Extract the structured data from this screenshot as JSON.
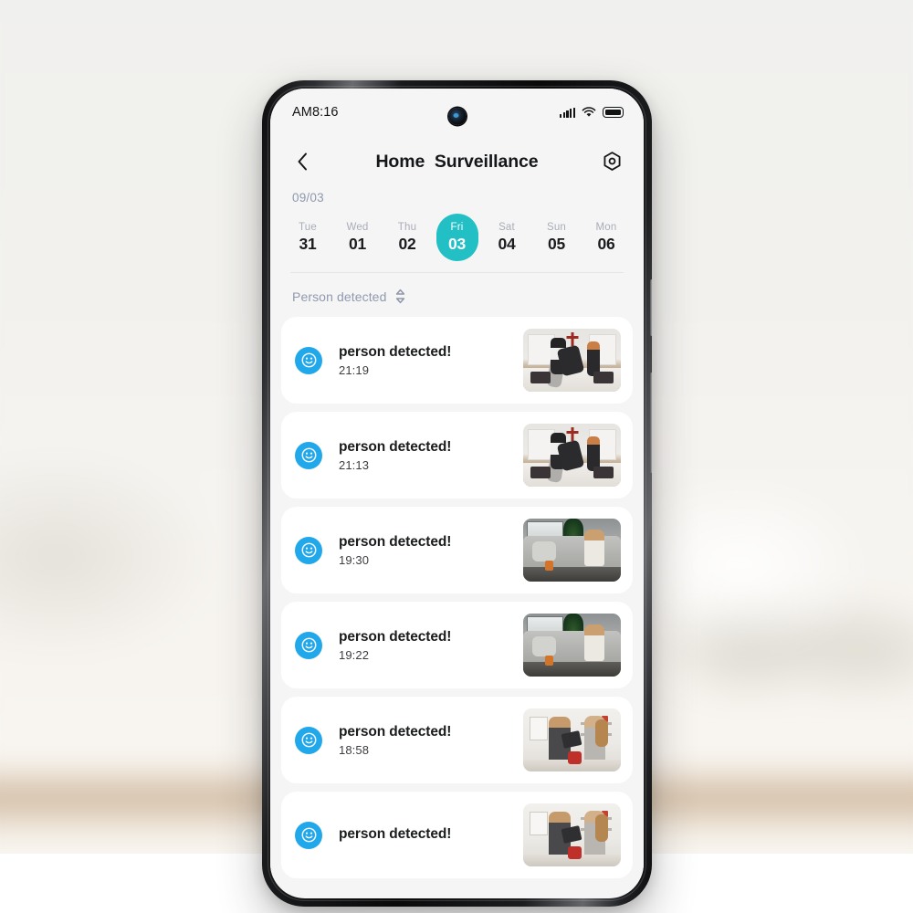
{
  "status_bar": {
    "time": "AM8:16",
    "icons": [
      "signal-bars-icon",
      "wifi-icon",
      "battery-icon"
    ]
  },
  "app_bar": {
    "back_icon": "chevron-left-icon",
    "title": "Home  Surveillance",
    "settings_icon": "hex-gear-icon"
  },
  "date_picker": {
    "month_label": "09/03",
    "days": [
      {
        "name": "Tue",
        "num": "31",
        "active": false
      },
      {
        "name": "Wed",
        "num": "01",
        "active": false
      },
      {
        "name": "Thu",
        "num": "02",
        "active": false
      },
      {
        "name": "Fri",
        "num": "03",
        "active": true
      },
      {
        "name": "Sat",
        "num": "04",
        "active": false
      },
      {
        "name": "Sun",
        "num": "05",
        "active": false
      },
      {
        "name": "Mon",
        "num": "06",
        "active": false
      }
    ],
    "active_color": "#22bfc4"
  },
  "filter": {
    "label": "Person detected",
    "sort_icon": "chevron-up-down-icon"
  },
  "events": [
    {
      "title": "person detected!",
      "time": "21:19",
      "avatar_icon": "smiley-face-icon",
      "thumb": "th-pillow"
    },
    {
      "title": "person detected!",
      "time": "21:13",
      "avatar_icon": "smiley-face-icon",
      "thumb": "th-pillow"
    },
    {
      "title": "person detected!",
      "time": "19:30",
      "avatar_icon": "smiley-face-icon",
      "thumb": "th-couch"
    },
    {
      "title": "person detected!",
      "time": "19:22",
      "avatar_icon": "smiley-face-icon",
      "thumb": "th-couch"
    },
    {
      "title": "person detected!",
      "time": "18:58",
      "avatar_icon": "smiley-face-icon",
      "thumb": "th-kitchen"
    },
    {
      "title": "person detected!",
      "time": "",
      "avatar_icon": "smiley-face-icon",
      "thumb": "th-kitchen"
    }
  ],
  "colors": {
    "accent_teal": "#22bfc4",
    "avatar_blue": "#21a8ea",
    "screen_bg": "#f5f5f6",
    "card_bg": "#ffffff",
    "text_primary": "#1b1c1e",
    "text_muted": "#9099ad"
  }
}
